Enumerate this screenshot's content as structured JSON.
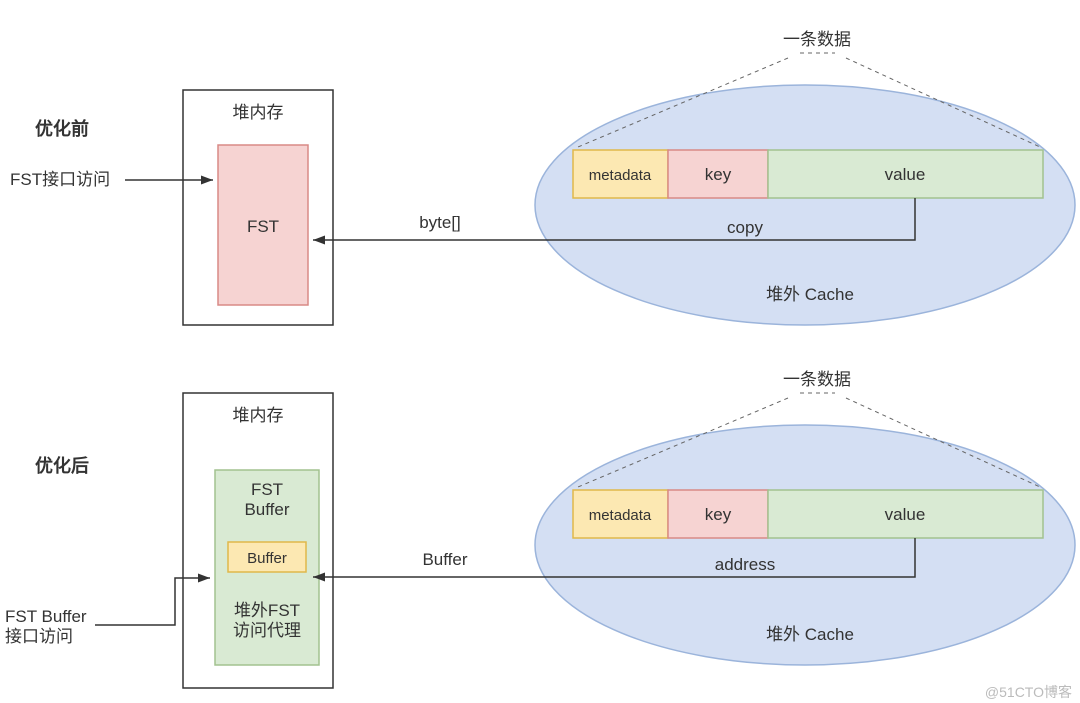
{
  "top": {
    "section_label": "优化前",
    "heap_title": "堆内存",
    "fst_label": "FST",
    "access_label": "FST接口访问",
    "arrow_label": "byte[]",
    "record_label": "一条数据",
    "metadata": "metadata",
    "key": "key",
    "value": "value",
    "copy": "copy",
    "cache_label": "堆外 Cache"
  },
  "bottom": {
    "section_label": "优化后",
    "heap_title": "堆内存",
    "fst_buffer": "FST\nBuffer",
    "buffer_inner": "Buffer",
    "proxy": "堆外FST\n访问代理",
    "access_label": "FST Buffer\n接口访问",
    "arrow_label": "Buffer",
    "record_label": "一条数据",
    "metadata": "metadata",
    "key": "key",
    "value": "value",
    "address": "address",
    "cache_label": "堆外 Cache"
  },
  "watermark": "@51CTO博客"
}
